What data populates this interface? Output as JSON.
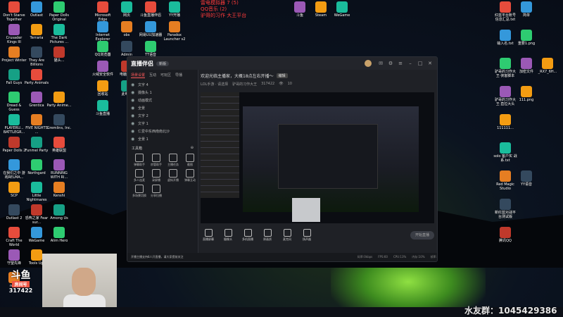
{
  "desktop_left": [
    [
      "Don't Starve Together",
      "Outlast",
      "Paper Dolls Original"
    ],
    [
      "Crusader Kings III",
      "Terraria",
      "The Dark Pictures ..."
    ],
    [
      "Project Winter",
      "They Are Billions",
      "猫头..."
    ],
    [
      "Fall Guys",
      "Party Animals"
    ],
    [
      "Dread & Guess",
      "Grentica",
      "Party Anime..."
    ],
    [
      "PLAYERU... BATTLEGR...",
      "FIVE NIGHTS ...",
      "Gremlins, Inc."
    ],
    [
      "Paper Dolls 2",
      "Funmel Party",
      "英雄联盟"
    ],
    [
      "在我们之中 游戏RELMA...",
      "Northgard",
      "RUNNING WITH RI..."
    ],
    [
      "SCP",
      "Little Nightmares",
      "Kenshi"
    ],
    [
      "Outlast 2",
      "恐怖之家 Fear sur...",
      "Among Us"
    ],
    [
      "Craft The World",
      "WeGame",
      "Alim Hero"
    ],
    [
      "守望先锋",
      "Tools Upl"
    ],
    [
      "redis"
    ]
  ],
  "desktop_mid": [
    "Microsoft Edge",
    "Internet Explorer",
    "QQ浏览器",
    "火绒安全软件",
    "回收站",
    "斗鱼直播"
  ],
  "desktop_mid2": [
    "网页",
    "obs",
    "Admin",
    "电脑管家",
    "此电脑"
  ],
  "desktop_mid3": [
    "斗鱼直播伴侣",
    "网易UU加速器",
    "TT语音"
  ],
  "desktop_mid4": [
    "YY开播",
    "Paradox Launcher v2"
  ],
  "desktop_top": [
    "斗鱼",
    "Steam",
    "WeGame"
  ],
  "desktop_right": [
    [
      "红蓝平台账号 信息汇总.txt",
      "简单"
    ],
    [
      "输入名.txt",
      "重要1.png"
    ],
    [
      "驴哥的习作大 王·侠客脚本",
      "加密文件",
      "_RX7_6H..."
    ],
    [
      "驴哥的习作大 王·直拉大头",
      "111.png"
    ],
    [
      "111111..."
    ],
    [
      "solo 客户实 战系.txt"
    ],
    [
      "Red Magic Studio",
      "YY语音"
    ],
    [
      "新红蓝对战平 台测试版"
    ],
    [
      "腾讯QQ"
    ]
  ],
  "top_red": [
    "雷电模拟器 7 (5)",
    "QQ音乐 (2)",
    "驴哥的习作 大王平台"
  ],
  "app": {
    "logo": "直播伴侣",
    "version": "新版",
    "tabs": [
      "场景设置",
      "互动",
      "可玩区",
      "导播"
    ],
    "scenes": [
      "文字 4",
      "摄像头 1",
      "动画模式",
      "全景",
      "文字 2",
      "文字 1",
      "仁爱中东西南南北沙",
      "全景 1"
    ],
    "tools_title": "工具箱",
    "tools": [
      "弹幕助手",
      "房管助手",
      "主播任务",
      "截图",
      "多人连麦",
      "录屏播",
      "虚拟开播",
      "弹幕互动",
      "多场景切换",
      "分享拉播"
    ],
    "stream_title": "欢迎光临主播家，大概18点左右开播～",
    "edit_label": "编辑",
    "category": "LOL手游 · 请选择",
    "room_name": "驴哥的习作大王",
    "room_id": "317422",
    "viewers": "10",
    "bottom_tools": [
      "直播屏幕",
      "摄像头",
      "多机直播",
      "原画质",
      "麦克风",
      "扬声器"
    ],
    "start_live": "开始直播",
    "status_notice": "开播主播支持8人开直播，请大家提前关注",
    "status_items": [
      "码率:0kbps",
      "FPS:60",
      "CPU:13%",
      "内存:10%",
      "帧率:60"
    ]
  },
  "room_badge": {
    "top": "斗鱼",
    "label": "房间号",
    "number": "317422"
  },
  "watermark": "水友群：1045429386"
}
